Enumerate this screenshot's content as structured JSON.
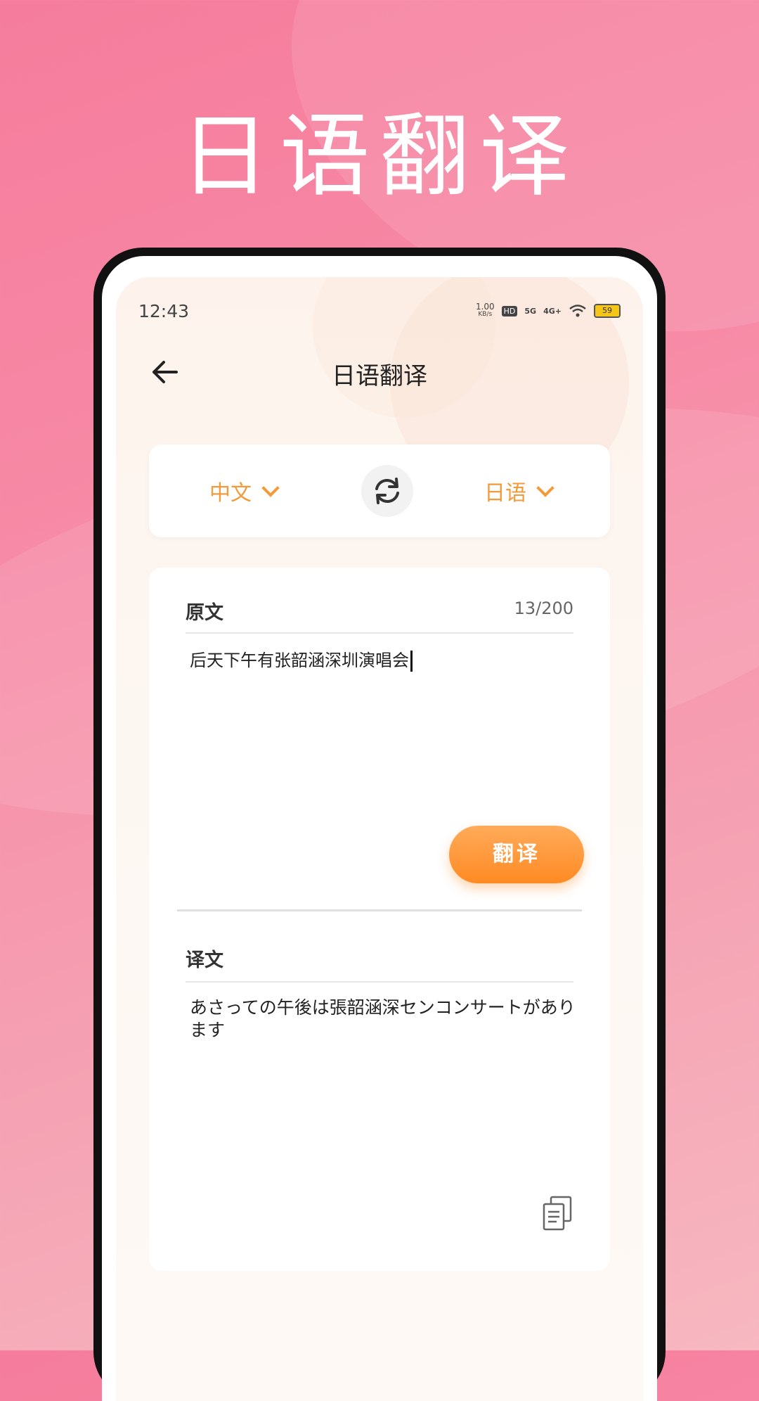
{
  "hero": {
    "title": "日语翻译"
  },
  "status_bar": {
    "time": "12:43",
    "net_speed": "1.00",
    "net_unit": "KB/s",
    "hd": "HD",
    "sig1": "5G",
    "sig2": "4G+",
    "battery": "59"
  },
  "nav": {
    "title": "日语翻译"
  },
  "languages": {
    "source": "中文",
    "target": "日语"
  },
  "source_panel": {
    "label": "原文",
    "counter": "13/200",
    "text": "后天下午有张韶涵深圳演唱会"
  },
  "translate_button": {
    "label": "翻译"
  },
  "result_panel": {
    "label": "译文",
    "text": "あさっての午後は張韶涵深センコンサートがあります"
  },
  "colors": {
    "accent": "#f39a3a",
    "button": "#ff8a23",
    "background": "#f57c9c"
  }
}
